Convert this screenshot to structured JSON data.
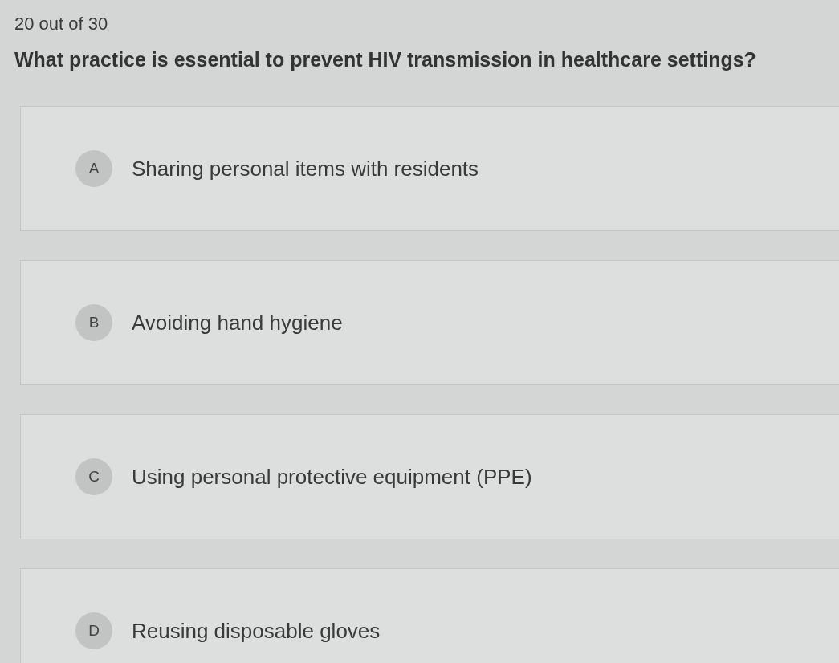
{
  "progress": "20 out of 30",
  "question": "What practice is essential to prevent HIV transmission in healthcare settings?",
  "options": [
    {
      "letter": "A",
      "text": "Sharing personal items with residents"
    },
    {
      "letter": "B",
      "text": "Avoiding hand hygiene"
    },
    {
      "letter": "C",
      "text": "Using personal protective equipment (PPE)"
    },
    {
      "letter": "D",
      "text": "Reusing disposable gloves"
    }
  ]
}
